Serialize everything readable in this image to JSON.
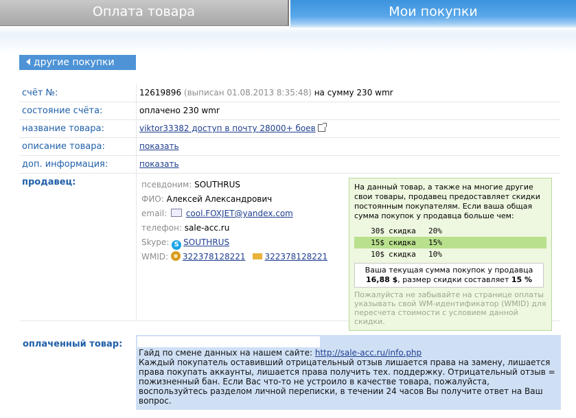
{
  "tabs": {
    "left_label": "Оплата товара",
    "right_label": "Мои покупки"
  },
  "back_button": {
    "label": "другие покупки"
  },
  "invoice": {
    "rows": [
      {
        "label": "счёт №:",
        "number": "12619896",
        "issued": "(выписан 01.08.2013 8:35:48)",
        "amount": "на сумму 230 wmr"
      },
      {
        "label": "состояние счёта:",
        "value": "оплачено 230 wmr"
      },
      {
        "label": "название товара:",
        "value": "viktor33382 доступ в почту 28000+ боев"
      },
      {
        "label": "описание товара:",
        "value": "показать"
      },
      {
        "label": "доп. информация:",
        "value": "показать"
      }
    ]
  },
  "seller": {
    "label": "продавец:",
    "alias_key": "псевдоним:",
    "alias": "SOUTHRUS",
    "name_key": "ФИО:",
    "name": "Алексей Александрович",
    "email_key": "email:",
    "email": "cool.FOXJET@yandex.com",
    "phone_key": "телефон:",
    "phone": "sale-acc.ru",
    "skype_key": "Skype:",
    "skype": "SOUTHRUS",
    "wmid_key": "WMID:",
    "wmid": "322378128221",
    "wmid_msg": "322378128221"
  },
  "discount": {
    "intro": "На данный товар, а также на многие другие свои товары, продавец предоставляет скидки постоянным покупателям. Если ваша общая сумма покупок у продавца больше чем:",
    "tiers": [
      {
        "amount": "30$",
        "word": "скидка",
        "pct": "20%"
      },
      {
        "amount": "15$",
        "word": "скидка",
        "pct": "15%"
      },
      {
        "amount": "10$",
        "word": "скидка",
        "pct": "10%"
      }
    ],
    "current_line1": "Ваша текущая сумма покупок у продавца",
    "current_sum": "16,88 $",
    "current_mid": ", размер скидки составляет",
    "current_pct": "15 %",
    "note": "Пожалуйста не забывайте на странице оплаты указывать свой WM-идентификатор (WMID) для пересчета стоимости с условием данной скидки."
  },
  "paid": {
    "label": "оплаченный товар:",
    "guide_text": "Гайд по смене данных на нашем сайте:",
    "guide_link": "http://sale-acc.ru/info.php",
    "body": "Каждый покупатель оставивший отрицательный отзыв лишается права на замену, лишается права покупать аккаунты, лишается права получить тех. поддержку. Отрицательный отзыв = пожизненный бан. Если Вас что-то не устроило в качестве товара, пожалуйста, воспользуйтесь разделом личной переписки, в течении 24 часов Вы получите ответ на Ваш вопрос."
  },
  "colors": {
    "accent": "#4d93d6",
    "label_blue": "#1f5fa8",
    "discount_bg": "#eef7df",
    "highlight": "#b9e08d",
    "paid_bg": "#cfe0f5"
  },
  "icons": [
    "triangle-left-icon",
    "external-link-icon",
    "mail-icon",
    "skype-icon",
    "webmoney-icon",
    "envelope-icon"
  ]
}
